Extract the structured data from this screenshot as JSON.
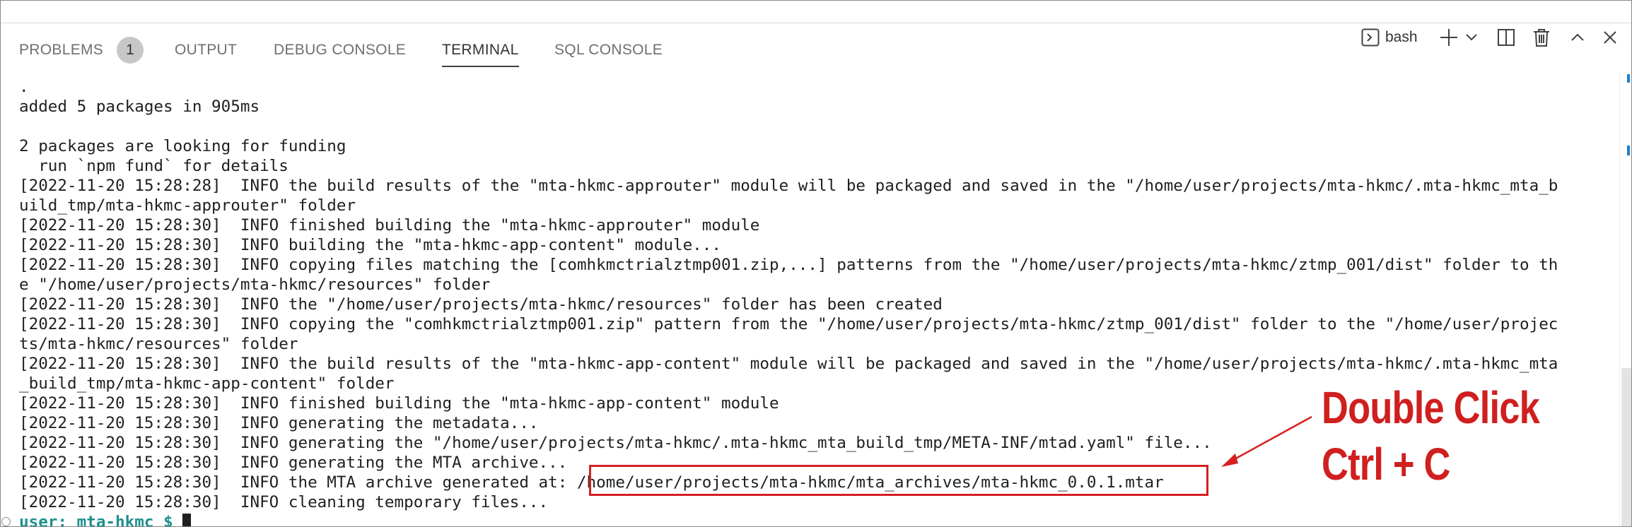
{
  "panel": {
    "tabs": [
      {
        "label": "PROBLEMS",
        "badge": "1"
      },
      {
        "label": "OUTPUT"
      },
      {
        "label": "DEBUG CONSOLE"
      },
      {
        "label": "TERMINAL",
        "active": true
      },
      {
        "label": "SQL CONSOLE"
      }
    ],
    "shell_name": "bash"
  },
  "terminal": {
    "lines": [
      ".",
      "added 5 packages in 905ms",
      "",
      "2 packages are looking for funding",
      "  run `npm fund` for details",
      "[2022-11-20 15:28:28]  INFO the build results of the \"mta-hkmc-approuter\" module will be packaged and saved in the \"/home/user/projects/mta-hkmc/.mta-hkmc_mta_b",
      "uild_tmp/mta-hkmc-approuter\" folder",
      "[2022-11-20 15:28:30]  INFO finished building the \"mta-hkmc-approuter\" module",
      "[2022-11-20 15:28:30]  INFO building the \"mta-hkmc-app-content\" module...",
      "[2022-11-20 15:28:30]  INFO copying files matching the [comhkmctrialztmp001.zip,...] patterns from the \"/home/user/projects/mta-hkmc/ztmp_001/dist\" folder to th",
      "e \"/home/user/projects/mta-hkmc/resources\" folder",
      "[2022-11-20 15:28:30]  INFO the \"/home/user/projects/mta-hkmc/resources\" folder has been created",
      "[2022-11-20 15:28:30]  INFO copying the \"comhkmctrialztmp001.zip\" pattern from the \"/home/user/projects/mta-hkmc/ztmp_001/dist\" folder to the \"/home/user/projec",
      "ts/mta-hkmc/resources\" folder",
      "[2022-11-20 15:28:30]  INFO the build results of the \"mta-hkmc-app-content\" module will be packaged and saved in the \"/home/user/projects/mta-hkmc/.mta-hkmc_mta",
      "_build_tmp/mta-hkmc-app-content\" folder",
      "[2022-11-20 15:28:30]  INFO finished building the \"mta-hkmc-app-content\" module",
      "[2022-11-20 15:28:30]  INFO generating the metadata...",
      "[2022-11-20 15:28:30]  INFO generating the \"/home/user/projects/mta-hkmc/.mta-hkmc_mta_build_tmp/META-INF/mtad.yaml\" file...",
      "[2022-11-20 15:28:30]  INFO generating the MTA archive...",
      "[2022-11-20 15:28:30]  INFO the MTA archive generated at: /home/user/projects/mta-hkmc/mta_archives/mta-hkmc_0.0.1.mtar",
      "[2022-11-20 15:28:30]  INFO cleaning temporary files..."
    ],
    "prompt_user": "user:",
    "prompt_dir": "mta-hkmc",
    "prompt_symbol": "$"
  },
  "annotation": {
    "line1": "Double Click",
    "line2": "Ctrl + C",
    "color": "#d01f1f"
  },
  "icons": [
    "terminal-icon",
    "plus-icon",
    "chevron-down-icon",
    "split-icon",
    "trash-icon",
    "chevron-up-icon",
    "close-icon"
  ]
}
